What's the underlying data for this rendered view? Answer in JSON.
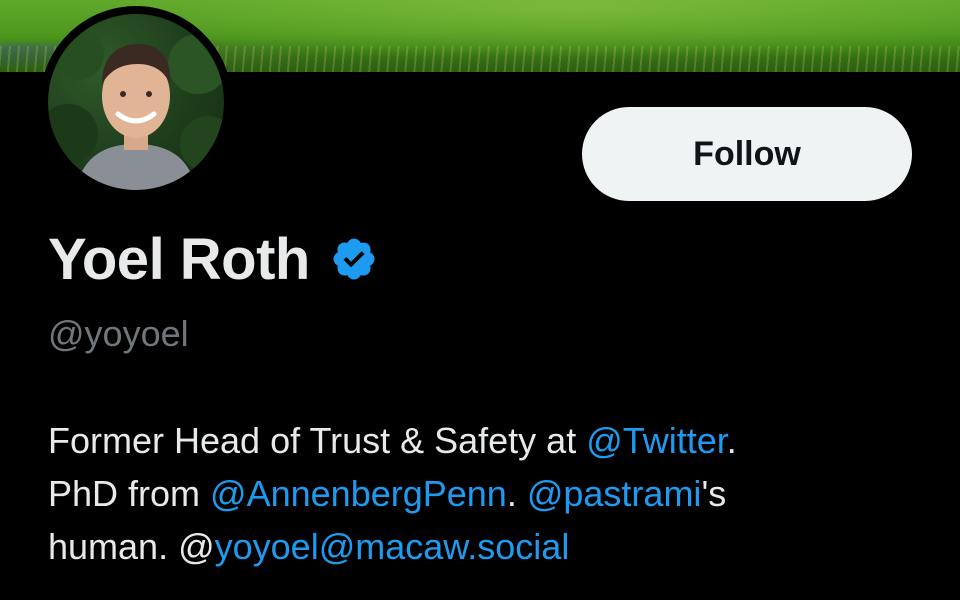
{
  "profile": {
    "display_name": "Yoel Roth",
    "handle": "@yoyoel",
    "verified_badge_color": "#1d9bf0",
    "verified_icon": "verified-badge-icon"
  },
  "actions": {
    "follow_label": "Follow"
  },
  "bio": {
    "line1": {
      "text_a": "Former Head of Trust & Safety at ",
      "mention_twitter": "@Twitter",
      "text_b": "."
    },
    "line2": {
      "text_a": "PhD from ",
      "mention_annenberg": "@AnnenbergPenn",
      "text_b": ". ",
      "mention_pastrami": "@pastrami",
      "text_c": "'s"
    },
    "line3": {
      "text_a": "human. @",
      "mention_macaw": "yoyoel@macaw.social"
    }
  },
  "colors": {
    "background": "#000000",
    "text_primary": "#e7e9ea",
    "text_secondary": "#71767b",
    "link": "#1d9bf0",
    "button_bg": "#eff3f4"
  }
}
